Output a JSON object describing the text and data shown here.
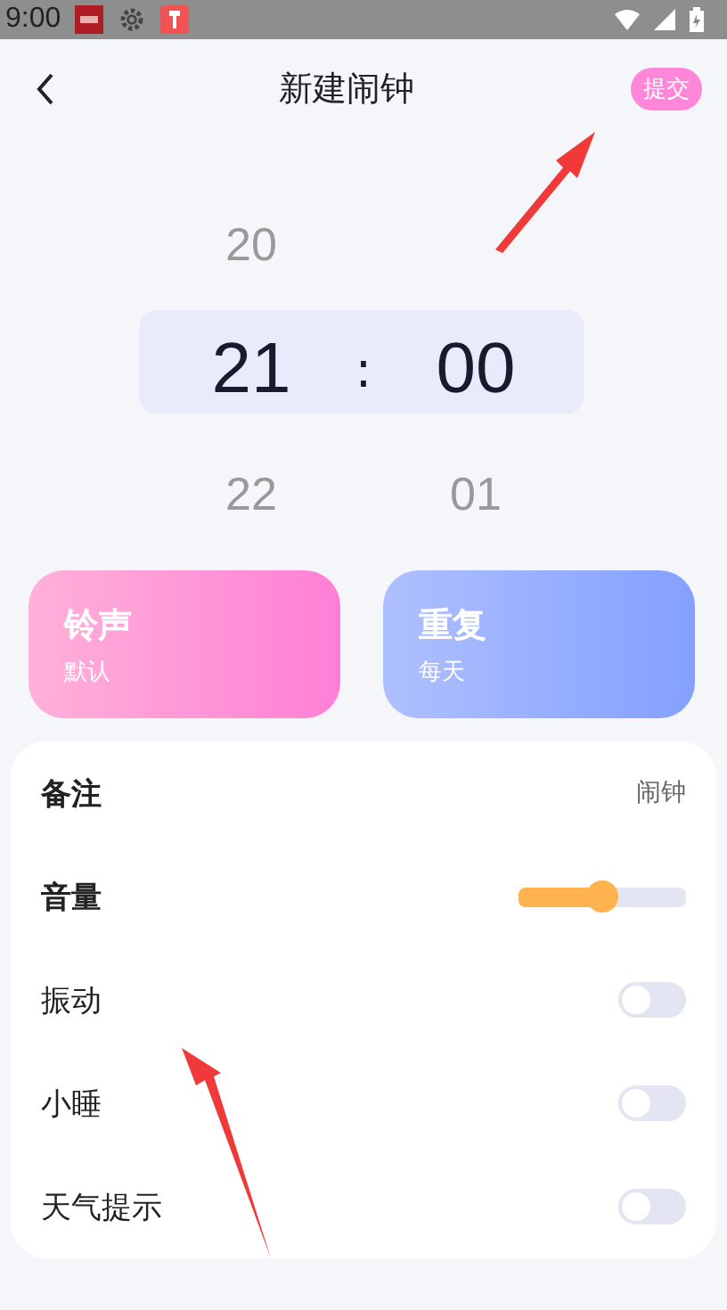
{
  "status_bar": {
    "time": "9:00"
  },
  "header": {
    "title": "新建闹钟",
    "submit": "提交"
  },
  "picker": {
    "separator": ":",
    "hour_column": [
      {
        "value": "20",
        "selected": false
      },
      {
        "value": "21",
        "selected": true
      },
      {
        "value": "22",
        "selected": false
      }
    ],
    "minute_column": [
      {
        "value": "00",
        "selected": true
      },
      {
        "value": "01",
        "selected": false
      }
    ]
  },
  "cards": [
    {
      "kind": "pink",
      "title": "铃声",
      "value": "默认"
    },
    {
      "kind": "blue",
      "title": "重复",
      "value": "每天"
    }
  ],
  "settings": [
    {
      "kind": "text",
      "label": "备注",
      "value": "闹钟"
    },
    {
      "kind": "slider",
      "label": "音量",
      "level": 0.5
    },
    {
      "kind": "switch",
      "label": "振动",
      "on": false
    },
    {
      "kind": "switch",
      "label": "小睡",
      "on": false
    },
    {
      "kind": "switch",
      "label": "天气提示",
      "on": false
    }
  ]
}
